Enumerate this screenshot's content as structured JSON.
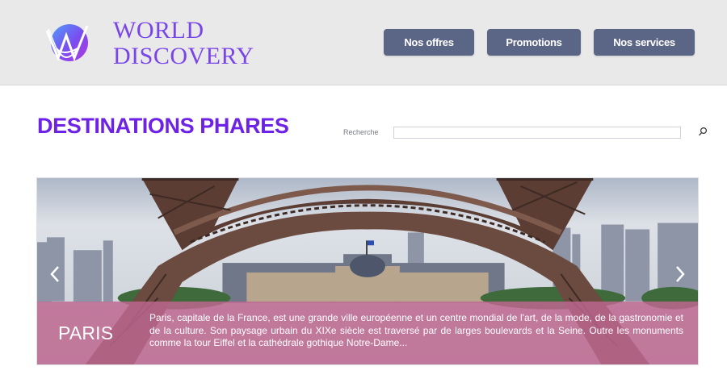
{
  "header": {
    "logo": {
      "name_line1": "WORLD",
      "name_line2": "DISCOVERY",
      "mark": "world-discovery-monogram-icon"
    },
    "nav": [
      {
        "label": "Nos offres"
      },
      {
        "label": "Promotions"
      },
      {
        "label": "Nos services"
      }
    ]
  },
  "main": {
    "title": "DESTINATIONS PHARES",
    "search": {
      "label": "Recherche",
      "value": "",
      "placeholder": "",
      "icon": "search-icon"
    },
    "slider": {
      "image": "eiffel-tower-photo",
      "prev_icon": "chevron-left-icon",
      "next_icon": "chevron-right-icon",
      "caption": {
        "city": "PARIS",
        "text": "Paris, capitale de la France, est une grande ville européenne et un centre mondial de l'art, de la mode, de la gastronomie et de la culture. Son paysage urbain du XIXe siècle est traversé par de larges boulevards et la Seine. Outre les monuments comme la tour Eiffel et la cathédrale gothique Notre-Dame..."
      }
    }
  },
  "colors": {
    "header_bg": "#e9e9ea",
    "nav_button": "#5b6586",
    "accent_purple": "#6d22e6",
    "caption_bg": "#bd668f"
  }
}
